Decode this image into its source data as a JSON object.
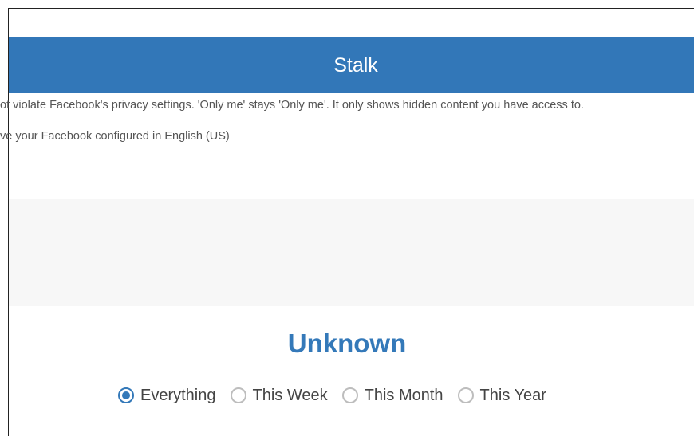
{
  "header": {
    "title": "Stalk"
  },
  "notices": [
    "ot violate Facebook's privacy settings. 'Only me' stays 'Only me'. It only shows hidden content you have access to.",
    "ve your Facebook configured in English (US)"
  ],
  "result": {
    "title": "Unknown"
  },
  "time_filter": {
    "selected": "Everything",
    "options": [
      "Everything",
      "This Week",
      "This Month",
      "This Year"
    ]
  },
  "colors": {
    "accent": "#3277b8",
    "title_text": "#3479b9",
    "panel_background": "#f7f7f7"
  }
}
